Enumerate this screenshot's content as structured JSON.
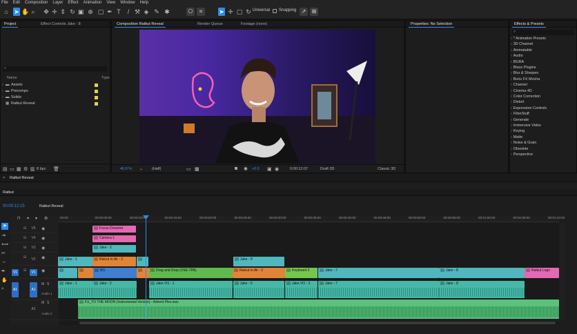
{
  "menu": [
    "File",
    "Edit",
    "Composition",
    "Layer",
    "Effect",
    "Animation",
    "View",
    "Window",
    "Help"
  ],
  "toolbar": {
    "universal_label": "Universal",
    "snapping_label": "Snapping"
  },
  "project_panel": {
    "tab": "Project",
    "tab2": "Effect Controls Jake : 8",
    "col_name": "Name",
    "col_type": "Type",
    "items": [
      {
        "name": "Assets",
        "color": "#e4d24a"
      },
      {
        "name": "Precomps",
        "color": "#e4d24a"
      },
      {
        "name": "Solids",
        "color": "#e4d24a"
      },
      {
        "name": "Ratkut Reveal",
        "color": "#e4d24a"
      }
    ],
    "bpc": "8 bpc"
  },
  "comp_panel": {
    "tabs": [
      "Composition Ratkut Reveal",
      "Render Queue",
      "Footage (none)"
    ],
    "zoom": "46.8 %",
    "resolution": "(Half)",
    "timecode": "0:00:12:07",
    "renderer": "Draft 3D",
    "mode": "Classic 3D"
  },
  "properties_panel": {
    "title": "Properties: No Selection"
  },
  "effects_panel": {
    "title": "Effects & Presets",
    "items": [
      "* Animation Presets",
      "3D Channel",
      "Animatable",
      "Audio",
      "BGRA",
      "Blace Plugins",
      "Blur & Sharpen",
      "Boris FX Mocha",
      "Channel",
      "Cinema 4D",
      "Color Correction",
      "Distort",
      "Expression Controls",
      "FilterStuff",
      "Generate",
      "Immersive Video",
      "Keying",
      "Matte",
      "Noise & Grain",
      "Obsolete",
      "Perspective"
    ]
  },
  "timeline": {
    "tab": "Ratkut Reveal",
    "seq_label": "Ratkut",
    "timecode": "00:00:12:15",
    "seq_name": "Ratkut Reveal",
    "ruler": [
      "00:00",
      "00:00:05:00",
      "00:00:10:00",
      "00:00:15:00",
      "00:00:20:00",
      "00:00:25:00",
      "00:00:30:00",
      "00:00:35:00",
      "00:00:40:00",
      "00:00:45:00",
      "00:00:50:00",
      "00:00:55:00",
      "00:01:00:00",
      "00:01:05:00",
      "00:01:10:00"
    ],
    "tracks": {
      "v5": "V5",
      "v4": "V4",
      "v3": "V3",
      "v2": "V2",
      "v1": "V1",
      "a1": "A1",
      "a2": "A2",
      "audio1": "Audio 1",
      "audio2": "Audio 2"
    },
    "clips_v5": "Focus Dreamer",
    "clips_v4": "Camera 1",
    "clips_v3": "Jake - 2",
    "clips_v2": [
      "Jake - 1",
      "Ratcut in Air - 2",
      "Jake - 8"
    ],
    "clips_v1": [
      "",
      "BG",
      "Drag and Drop (VSE-TPA)",
      "Ratcut in Air - 2",
      "Keyboard 2",
      "Jake - 7",
      "Jake - 8",
      "Ratkut Logo"
    ],
    "clips_a1": [
      "Jake - 1",
      "Jake - 2",
      "Jake VI1 - 1",
      "Jake - 6",
      "Jake VO - 2",
      "Jake - 7",
      "Jake - 8"
    ],
    "music": "FX_TO THE MOON (Instrumental Version) - Advent Plex.wav",
    "colors": {
      "teal": "#4fb7bd",
      "pink": "#e369b2",
      "orange": "#e28437",
      "blue": "#3e7fd3",
      "green": "#5fb94f",
      "lime": "#74c74e",
      "audio": "#47b7a6",
      "music": "#5bc27d",
      "accent": "#2d8ceb"
    }
  }
}
